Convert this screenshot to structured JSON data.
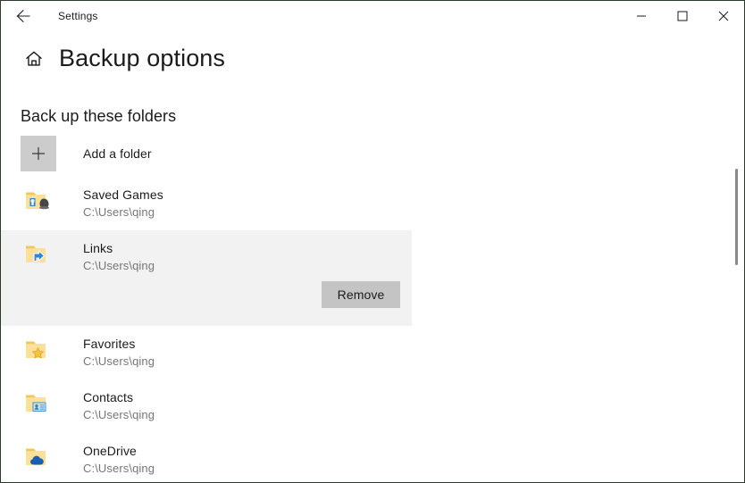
{
  "window": {
    "app_title": "Settings",
    "back_icon": "back-arrow-icon",
    "controls": {
      "minimize": "minimize-icon",
      "maximize": "maximize-icon",
      "close": "close-icon"
    }
  },
  "page": {
    "home_icon": "home-icon",
    "title": "Backup options",
    "section_heading": "Back up these folders"
  },
  "add_folder": {
    "icon": "plus-icon",
    "label": "Add a folder"
  },
  "folders": [
    {
      "name": "Saved Games",
      "path": "C:\\Users\\qing",
      "icon": "folder-saved-games-icon",
      "selected": false
    },
    {
      "name": "Links",
      "path": "C:\\Users\\qing",
      "icon": "folder-shortcut-icon",
      "selected": true,
      "action_label": "Remove"
    },
    {
      "name": "Favorites",
      "path": "C:\\Users\\qing",
      "icon": "folder-favorites-icon",
      "selected": false
    },
    {
      "name": "Contacts",
      "path": "C:\\Users\\qing",
      "icon": "folder-contacts-icon",
      "selected": false
    },
    {
      "name": "OneDrive",
      "path": "C:\\Users\\qing",
      "icon": "folder-onedrive-icon",
      "selected": false
    }
  ],
  "colors": {
    "selection_background": "#f2f2f2",
    "button_background": "#c4c4c4",
    "add_square_background": "#cccccc",
    "text_primary": "#1b1b1b",
    "text_secondary": "#767676",
    "folder_yellow": "#f7d98b",
    "accent_blue": "#1a8ce0"
  }
}
